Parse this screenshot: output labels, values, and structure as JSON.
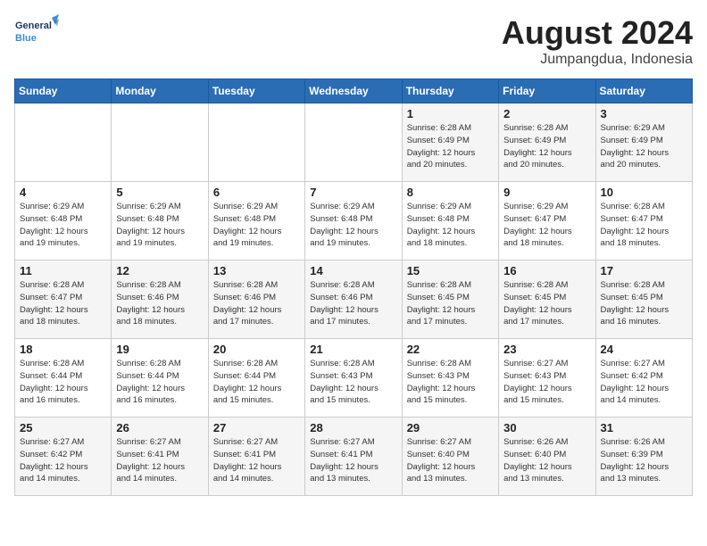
{
  "header": {
    "logo_line1": "General",
    "logo_line2": "Blue",
    "month_title": "August 2024",
    "location": "Jumpangdua, Indonesia"
  },
  "days_of_week": [
    "Sunday",
    "Monday",
    "Tuesday",
    "Wednesday",
    "Thursday",
    "Friday",
    "Saturday"
  ],
  "weeks": [
    [
      {
        "num": "",
        "info": ""
      },
      {
        "num": "",
        "info": ""
      },
      {
        "num": "",
        "info": ""
      },
      {
        "num": "",
        "info": ""
      },
      {
        "num": "1",
        "info": "Sunrise: 6:28 AM\nSunset: 6:49 PM\nDaylight: 12 hours\nand 20 minutes."
      },
      {
        "num": "2",
        "info": "Sunrise: 6:28 AM\nSunset: 6:49 PM\nDaylight: 12 hours\nand 20 minutes."
      },
      {
        "num": "3",
        "info": "Sunrise: 6:29 AM\nSunset: 6:49 PM\nDaylight: 12 hours\nand 20 minutes."
      }
    ],
    [
      {
        "num": "4",
        "info": "Sunrise: 6:29 AM\nSunset: 6:48 PM\nDaylight: 12 hours\nand 19 minutes."
      },
      {
        "num": "5",
        "info": "Sunrise: 6:29 AM\nSunset: 6:48 PM\nDaylight: 12 hours\nand 19 minutes."
      },
      {
        "num": "6",
        "info": "Sunrise: 6:29 AM\nSunset: 6:48 PM\nDaylight: 12 hours\nand 19 minutes."
      },
      {
        "num": "7",
        "info": "Sunrise: 6:29 AM\nSunset: 6:48 PM\nDaylight: 12 hours\nand 19 minutes."
      },
      {
        "num": "8",
        "info": "Sunrise: 6:29 AM\nSunset: 6:48 PM\nDaylight: 12 hours\nand 18 minutes."
      },
      {
        "num": "9",
        "info": "Sunrise: 6:29 AM\nSunset: 6:47 PM\nDaylight: 12 hours\nand 18 minutes."
      },
      {
        "num": "10",
        "info": "Sunrise: 6:28 AM\nSunset: 6:47 PM\nDaylight: 12 hours\nand 18 minutes."
      }
    ],
    [
      {
        "num": "11",
        "info": "Sunrise: 6:28 AM\nSunset: 6:47 PM\nDaylight: 12 hours\nand 18 minutes."
      },
      {
        "num": "12",
        "info": "Sunrise: 6:28 AM\nSunset: 6:46 PM\nDaylight: 12 hours\nand 18 minutes."
      },
      {
        "num": "13",
        "info": "Sunrise: 6:28 AM\nSunset: 6:46 PM\nDaylight: 12 hours\nand 17 minutes."
      },
      {
        "num": "14",
        "info": "Sunrise: 6:28 AM\nSunset: 6:46 PM\nDaylight: 12 hours\nand 17 minutes."
      },
      {
        "num": "15",
        "info": "Sunrise: 6:28 AM\nSunset: 6:45 PM\nDaylight: 12 hours\nand 17 minutes."
      },
      {
        "num": "16",
        "info": "Sunrise: 6:28 AM\nSunset: 6:45 PM\nDaylight: 12 hours\nand 17 minutes."
      },
      {
        "num": "17",
        "info": "Sunrise: 6:28 AM\nSunset: 6:45 PM\nDaylight: 12 hours\nand 16 minutes."
      }
    ],
    [
      {
        "num": "18",
        "info": "Sunrise: 6:28 AM\nSunset: 6:44 PM\nDaylight: 12 hours\nand 16 minutes."
      },
      {
        "num": "19",
        "info": "Sunrise: 6:28 AM\nSunset: 6:44 PM\nDaylight: 12 hours\nand 16 minutes."
      },
      {
        "num": "20",
        "info": "Sunrise: 6:28 AM\nSunset: 6:44 PM\nDaylight: 12 hours\nand 15 minutes."
      },
      {
        "num": "21",
        "info": "Sunrise: 6:28 AM\nSunset: 6:43 PM\nDaylight: 12 hours\nand 15 minutes."
      },
      {
        "num": "22",
        "info": "Sunrise: 6:28 AM\nSunset: 6:43 PM\nDaylight: 12 hours\nand 15 minutes."
      },
      {
        "num": "23",
        "info": "Sunrise: 6:27 AM\nSunset: 6:43 PM\nDaylight: 12 hours\nand 15 minutes."
      },
      {
        "num": "24",
        "info": "Sunrise: 6:27 AM\nSunset: 6:42 PM\nDaylight: 12 hours\nand 14 minutes."
      }
    ],
    [
      {
        "num": "25",
        "info": "Sunrise: 6:27 AM\nSunset: 6:42 PM\nDaylight: 12 hours\nand 14 minutes."
      },
      {
        "num": "26",
        "info": "Sunrise: 6:27 AM\nSunset: 6:41 PM\nDaylight: 12 hours\nand 14 minutes."
      },
      {
        "num": "27",
        "info": "Sunrise: 6:27 AM\nSunset: 6:41 PM\nDaylight: 12 hours\nand 14 minutes."
      },
      {
        "num": "28",
        "info": "Sunrise: 6:27 AM\nSunset: 6:41 PM\nDaylight: 12 hours\nand 13 minutes."
      },
      {
        "num": "29",
        "info": "Sunrise: 6:27 AM\nSunset: 6:40 PM\nDaylight: 12 hours\nand 13 minutes."
      },
      {
        "num": "30",
        "info": "Sunrise: 6:26 AM\nSunset: 6:40 PM\nDaylight: 12 hours\nand 13 minutes."
      },
      {
        "num": "31",
        "info": "Sunrise: 6:26 AM\nSunset: 6:39 PM\nDaylight: 12 hours\nand 13 minutes."
      }
    ]
  ]
}
